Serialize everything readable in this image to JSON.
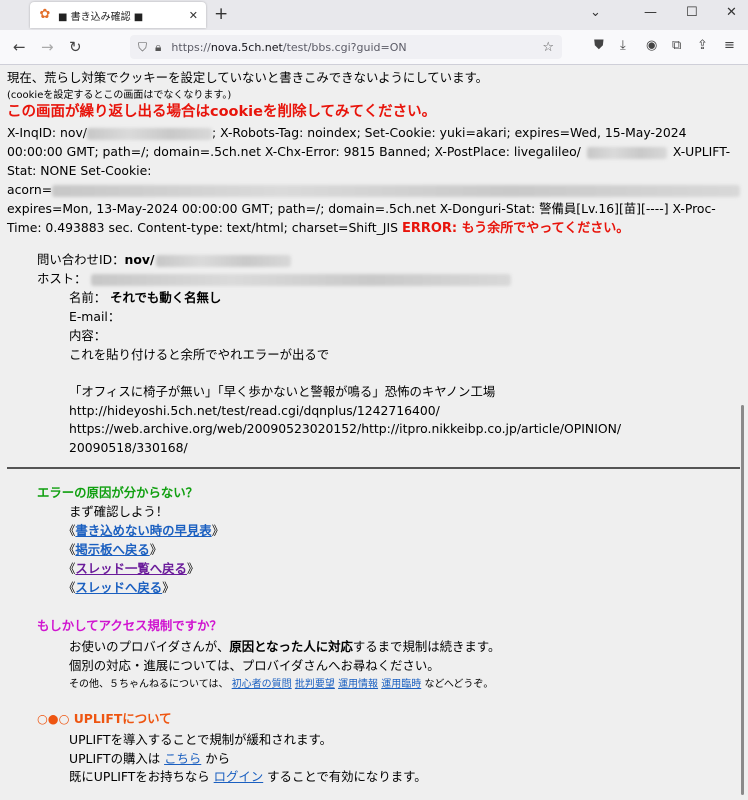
{
  "browser": {
    "tab_title": "■ 書き込み確認 ■",
    "url_domain": "nova.5ch.net",
    "url_prefix": "https://",
    "url_path": "/test/bbs.cgi?guid=ON"
  },
  "notice": {
    "line1": "現在、荒らし対策でクッキーを設定していないと書きこみできないようにしています。",
    "line2": "(cookieを設定するとこの画面はでなくなります。)",
    "warning": "この画面が繰り返し出る場合はcookieを削除してみてください。"
  },
  "headers": {
    "l1a": "X-InqID: nov/",
    "l1b": "; X-Robots-Tag: noindex; Set-Cookie: yuki=akari; expires=Wed, 15-May-2024",
    "l2a": "00:00:00 GMT; path=/; domain=.5ch.net X-Chx-Error: 9815 Banned; X-PostPlace: livegalileo/",
    "l2b": "X-UPLIFT-",
    "l3": "Stat: NONE Set-Cookie:",
    "l4": "acorn=",
    "l5": "expires=Mon, 13-May-2024 00:00:00 GMT; path=/; domain=.5ch.net X-Donguri-Stat: 警備員[Lv.16][苗][----] X-Proc-",
    "l6": "Time: 0.493883 sec. Content-type: text/html; charset=Shift_JIS",
    "error": "ERROR: もう余所でやってください。"
  },
  "inquiry": {
    "id_label": "問い合わせID：",
    "id_value": "nov/",
    "host_label": "ホスト："
  },
  "post": {
    "name_label": "名前：",
    "name_value": "それでも動く名無し",
    "email_label": "E-mail：",
    "content_label": "内容：",
    "body_1": "これを貼り付けると余所でやれエラーが出るで",
    "body_2": "「オフィスに椅子が無い」「早く歩かないと警報が鳴る」恐怖のキヤノン工場",
    "body_3": "http://hideyoshi.5ch.net/test/read.cgi/dqnplus/1242716400/",
    "body_4": "https://web.archive.org/web/20090523020152/http://itpro.nikkeibp.co.jp/article/OPINION/",
    "body_5": "20090518/330168/"
  },
  "error_help": {
    "heading": "エラーの原因が分からない？",
    "check": "まず確認しよう！",
    "open": "《",
    "close": "》",
    "link1": "書き込めない時の早見表",
    "link2": "掲示板へ戻る",
    "link3": "スレッド一覧へ戻る",
    "link4": "スレッドへ戻る"
  },
  "access": {
    "heading": "もしかしてアクセス規制ですか？",
    "p1a": "お使いのプロバイダさんが、",
    "p1b": "原因となった人に対応",
    "p1c": "するまで規制は続きます。",
    "p2": "個別の対応・進展については、プロバイダさんへお尋ねください。",
    "p3a": "その他、５ちゃんねるについては、",
    "link_a": "初心者の質問",
    "link_b": "批判要望",
    "link_c": "運用情報",
    "link_d": "運用臨時",
    "p3b": "などへどうぞ。"
  },
  "uplift": {
    "heading": "○●○ UPLIFTについて",
    "l1": "UPLIFTを導入することで規制が緩和されます。",
    "l2a": "UPLIFTの購入は",
    "l2link": "こちら",
    "l2b": "から",
    "l3a": "既にUPLIFTをお持ちなら",
    "l3link": "ログイン",
    "l3b": "することで有効になります。"
  },
  "colors": {
    "error_red": "#e8140b",
    "green": "#10a010",
    "magenta": "#d014d0",
    "orange": "#ee5511",
    "link": "#1a5fc0"
  }
}
